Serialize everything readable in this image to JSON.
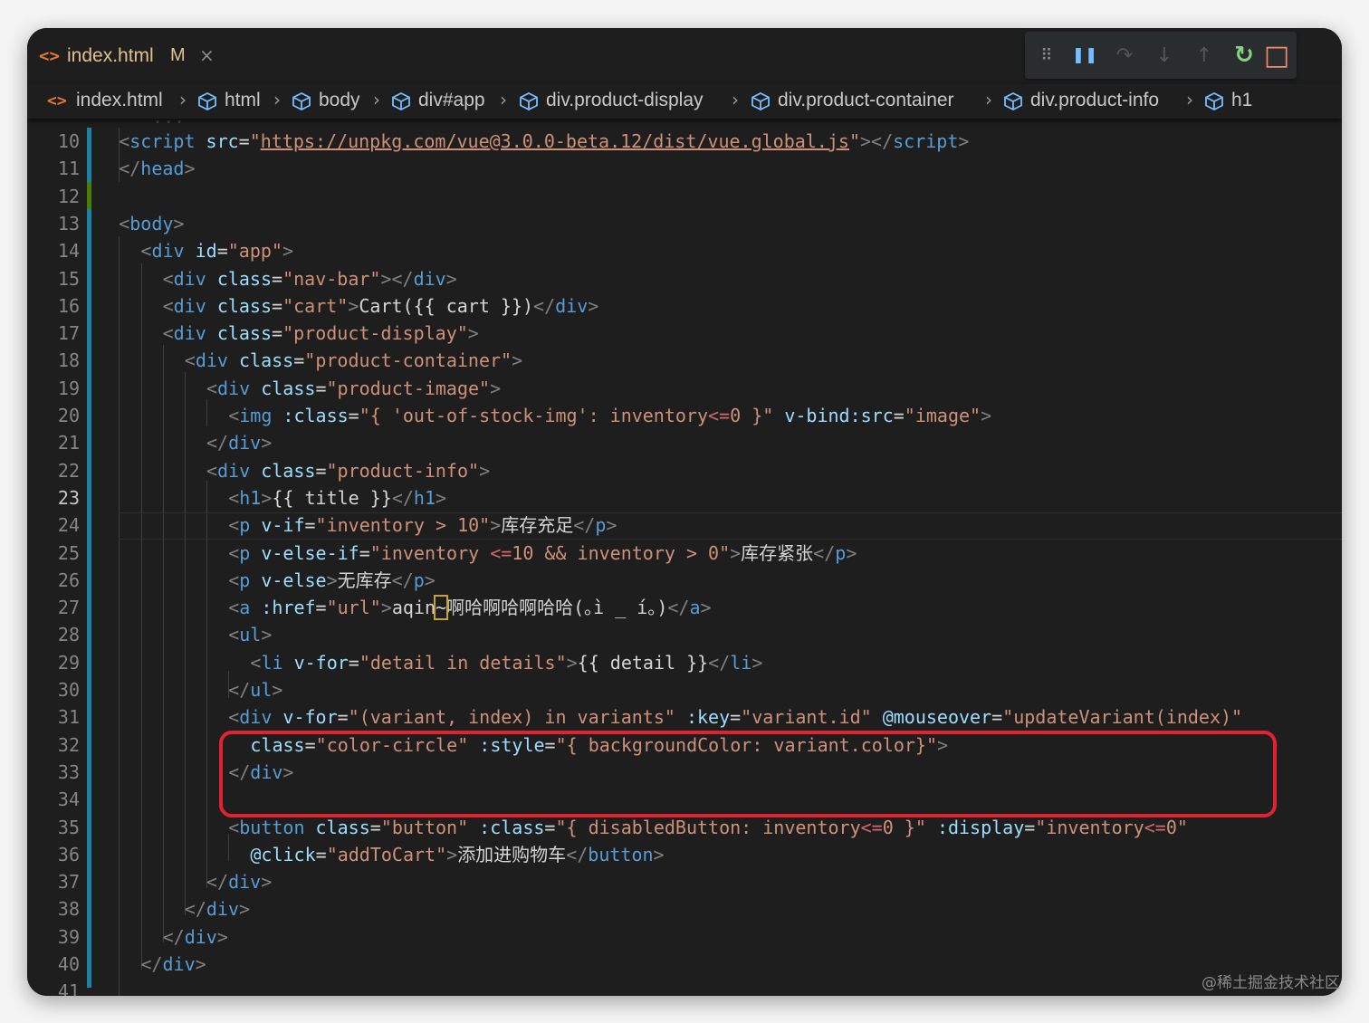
{
  "tab": {
    "icon": "<>",
    "name": "index.html",
    "status": "M",
    "close": "×"
  },
  "debug_toolbar": {
    "grip": "⠿",
    "pause": "❚❚",
    "step_over": "↷",
    "step_into": "↓",
    "step_out": "↑",
    "restart": "↻",
    "stop": "□"
  },
  "breadcrumb": {
    "file_icon": "<>",
    "items": [
      "index.html",
      "html",
      "body",
      "div#app",
      "div.product-display",
      "div.product-container",
      "div.product-info",
      "h1"
    ]
  },
  "editor": {
    "active_line": 23,
    "lines": [
      {
        "num": "10",
        "tokens": [
          {
            "t": "punct",
            "v": "<"
          },
          {
            "t": "tag",
            "v": "script"
          },
          {
            "t": "text",
            "v": " "
          },
          {
            "t": "attr",
            "v": "src"
          },
          {
            "t": "eq",
            "v": "="
          },
          {
            "t": "str",
            "v": "\""
          },
          {
            "t": "url",
            "v": "https://unpkg.com/vue@3.0.0-beta.12/dist/vue.global.js"
          },
          {
            "t": "str",
            "v": "\""
          },
          {
            "t": "punct",
            "v": "></"
          },
          {
            "t": "tag",
            "v": "script"
          },
          {
            "t": "punct",
            "v": ">"
          }
        ]
      },
      {
        "num": "11",
        "tokens": [
          {
            "t": "punct",
            "v": "</"
          },
          {
            "t": "tag",
            "v": "head"
          },
          {
            "t": "punct",
            "v": ">"
          }
        ]
      },
      {
        "num": "12",
        "tokens": []
      },
      {
        "num": "13",
        "tokens": [
          {
            "t": "punct",
            "v": "<"
          },
          {
            "t": "tag",
            "v": "body"
          },
          {
            "t": "punct",
            "v": ">"
          }
        ]
      },
      {
        "num": "14",
        "tokens": [
          {
            "t": "punct",
            "v": "<"
          },
          {
            "t": "tag",
            "v": "div"
          },
          {
            "t": "text",
            "v": " "
          },
          {
            "t": "attr",
            "v": "id"
          },
          {
            "t": "eq",
            "v": "="
          },
          {
            "t": "str",
            "v": "\"app\""
          },
          {
            "t": "punct",
            "v": ">"
          }
        ]
      },
      {
        "num": "15",
        "tokens": [
          {
            "t": "punct",
            "v": "<"
          },
          {
            "t": "tag",
            "v": "div"
          },
          {
            "t": "text",
            "v": " "
          },
          {
            "t": "attr",
            "v": "class"
          },
          {
            "t": "eq",
            "v": "="
          },
          {
            "t": "str",
            "v": "\"nav-bar\""
          },
          {
            "t": "punct",
            "v": "></"
          },
          {
            "t": "tag",
            "v": "div"
          },
          {
            "t": "punct",
            "v": ">"
          }
        ]
      },
      {
        "num": "16",
        "tokens": [
          {
            "t": "punct",
            "v": "<"
          },
          {
            "t": "tag",
            "v": "div"
          },
          {
            "t": "text",
            "v": " "
          },
          {
            "t": "attr",
            "v": "class"
          },
          {
            "t": "eq",
            "v": "="
          },
          {
            "t": "str",
            "v": "\"cart\""
          },
          {
            "t": "punct",
            "v": ">"
          },
          {
            "t": "text",
            "v": "Cart({{ cart }})"
          },
          {
            "t": "punct",
            "v": "</"
          },
          {
            "t": "tag",
            "v": "div"
          },
          {
            "t": "punct",
            "v": ">"
          }
        ]
      },
      {
        "num": "17",
        "tokens": [
          {
            "t": "punct",
            "v": "<"
          },
          {
            "t": "tag",
            "v": "div"
          },
          {
            "t": "text",
            "v": " "
          },
          {
            "t": "attr",
            "v": "class"
          },
          {
            "t": "eq",
            "v": "="
          },
          {
            "t": "str",
            "v": "\"product-display\""
          },
          {
            "t": "punct",
            "v": ">"
          }
        ]
      },
      {
        "num": "18",
        "tokens": [
          {
            "t": "punct",
            "v": "<"
          },
          {
            "t": "tag",
            "v": "div"
          },
          {
            "t": "text",
            "v": " "
          },
          {
            "t": "attr",
            "v": "class"
          },
          {
            "t": "eq",
            "v": "="
          },
          {
            "t": "str",
            "v": "\"product-container\""
          },
          {
            "t": "punct",
            "v": ">"
          }
        ]
      },
      {
        "num": "19",
        "tokens": [
          {
            "t": "punct",
            "v": "<"
          },
          {
            "t": "tag",
            "v": "div"
          },
          {
            "t": "text",
            "v": " "
          },
          {
            "t": "attr",
            "v": "class"
          },
          {
            "t": "eq",
            "v": "="
          },
          {
            "t": "str",
            "v": "\"product-image\""
          },
          {
            "t": "punct",
            "v": ">"
          }
        ]
      },
      {
        "num": "20",
        "tokens": [
          {
            "t": "punct",
            "v": "<"
          },
          {
            "t": "tag",
            "v": "img"
          },
          {
            "t": "text",
            "v": " "
          },
          {
            "t": "attr",
            "v": ":class"
          },
          {
            "t": "eq",
            "v": "="
          },
          {
            "t": "str",
            "v": "\"{ 'out-of-stock-img': inventory"
          },
          {
            "t": "op",
            "v": "<="
          },
          {
            "t": "str",
            "v": "0 }\""
          },
          {
            "t": "text",
            "v": " "
          },
          {
            "t": "attr",
            "v": "v-bind:src"
          },
          {
            "t": "eq",
            "v": "="
          },
          {
            "t": "str",
            "v": "\"image\""
          },
          {
            "t": "punct",
            "v": ">"
          }
        ]
      },
      {
        "num": "21",
        "tokens": [
          {
            "t": "punct",
            "v": "</"
          },
          {
            "t": "tag",
            "v": "div"
          },
          {
            "t": "punct",
            "v": ">"
          }
        ]
      },
      {
        "num": "22",
        "tokens": [
          {
            "t": "punct",
            "v": "<"
          },
          {
            "t": "tag",
            "v": "div"
          },
          {
            "t": "text",
            "v": " "
          },
          {
            "t": "attr",
            "v": "class"
          },
          {
            "t": "eq",
            "v": "="
          },
          {
            "t": "str",
            "v": "\"product-info\""
          },
          {
            "t": "punct",
            "v": ">"
          }
        ]
      },
      {
        "num": "23",
        "tokens": [
          {
            "t": "punct",
            "v": "<"
          },
          {
            "t": "tag",
            "v": "h1"
          },
          {
            "t": "punct",
            "v": ">"
          },
          {
            "t": "text",
            "v": "{{ title }}"
          },
          {
            "t": "punct",
            "v": "</"
          },
          {
            "t": "tag",
            "v": "h1"
          },
          {
            "t": "punct",
            "v": ">"
          }
        ]
      },
      {
        "num": "24",
        "tokens": [
          {
            "t": "punct",
            "v": "<"
          },
          {
            "t": "tag",
            "v": "p"
          },
          {
            "t": "text",
            "v": " "
          },
          {
            "t": "attr",
            "v": "v-if"
          },
          {
            "t": "eq",
            "v": "="
          },
          {
            "t": "str",
            "v": "\"inventory > 10\""
          },
          {
            "t": "punct",
            "v": ">"
          },
          {
            "t": "text",
            "v": "库存充足"
          },
          {
            "t": "punct",
            "v": "</"
          },
          {
            "t": "tag",
            "v": "p"
          },
          {
            "t": "punct",
            "v": ">"
          }
        ]
      },
      {
        "num": "25",
        "tokens": [
          {
            "t": "punct",
            "v": "<"
          },
          {
            "t": "tag",
            "v": "p"
          },
          {
            "t": "text",
            "v": " "
          },
          {
            "t": "attr",
            "v": "v-else-if"
          },
          {
            "t": "eq",
            "v": "="
          },
          {
            "t": "str",
            "v": "\"inventory "
          },
          {
            "t": "op",
            "v": "<="
          },
          {
            "t": "str",
            "v": "10 && inventory > 0\""
          },
          {
            "t": "punct",
            "v": ">"
          },
          {
            "t": "text",
            "v": "库存紧张"
          },
          {
            "t": "punct",
            "v": "</"
          },
          {
            "t": "tag",
            "v": "p"
          },
          {
            "t": "punct",
            "v": ">"
          }
        ]
      },
      {
        "num": "26",
        "tokens": [
          {
            "t": "punct",
            "v": "<"
          },
          {
            "t": "tag",
            "v": "p"
          },
          {
            "t": "text",
            "v": " "
          },
          {
            "t": "attr",
            "v": "v-else"
          },
          {
            "t": "punct",
            "v": ">"
          },
          {
            "t": "text",
            "v": "无库存"
          },
          {
            "t": "punct",
            "v": "</"
          },
          {
            "t": "tag",
            "v": "p"
          },
          {
            "t": "punct",
            "v": ">"
          }
        ]
      },
      {
        "num": "27",
        "tokens": [
          {
            "t": "punct",
            "v": "<"
          },
          {
            "t": "tag",
            "v": "a"
          },
          {
            "t": "text",
            "v": " "
          },
          {
            "t": "attr",
            "v": ":href"
          },
          {
            "t": "eq",
            "v": "="
          },
          {
            "t": "str",
            "v": "\"url\""
          },
          {
            "t": "punct",
            "v": ">"
          },
          {
            "t": "text",
            "v": "aqin"
          },
          {
            "t": "cursor",
            "v": "~"
          },
          {
            "t": "text",
            "v": "啊哈啊哈啊哈哈(｡ì _ í｡)"
          },
          {
            "t": "punct",
            "v": "</"
          },
          {
            "t": "tag",
            "v": "a"
          },
          {
            "t": "punct",
            "v": ">"
          }
        ]
      },
      {
        "num": "28",
        "tokens": [
          {
            "t": "punct",
            "v": "<"
          },
          {
            "t": "tag",
            "v": "ul"
          },
          {
            "t": "punct",
            "v": ">"
          }
        ]
      },
      {
        "num": "29",
        "tokens": [
          {
            "t": "punct",
            "v": "<"
          },
          {
            "t": "tag",
            "v": "li"
          },
          {
            "t": "text",
            "v": " "
          },
          {
            "t": "attr",
            "v": "v-for"
          },
          {
            "t": "eq",
            "v": "="
          },
          {
            "t": "str",
            "v": "\"detail in details\""
          },
          {
            "t": "punct",
            "v": ">"
          },
          {
            "t": "text",
            "v": "{{ detail }}"
          },
          {
            "t": "punct",
            "v": "</"
          },
          {
            "t": "tag",
            "v": "li"
          },
          {
            "t": "punct",
            "v": ">"
          }
        ]
      },
      {
        "num": "30",
        "tokens": [
          {
            "t": "punct",
            "v": "</"
          },
          {
            "t": "tag",
            "v": "ul"
          },
          {
            "t": "punct",
            "v": ">"
          }
        ]
      },
      {
        "num": "31",
        "tokens": [
          {
            "t": "punct",
            "v": "<"
          },
          {
            "t": "tag",
            "v": "div"
          },
          {
            "t": "text",
            "v": " "
          },
          {
            "t": "attr",
            "v": "v-for"
          },
          {
            "t": "eq",
            "v": "="
          },
          {
            "t": "str",
            "v": "\"(variant, index) in variants\""
          },
          {
            "t": "text",
            "v": " "
          },
          {
            "t": "attr",
            "v": ":key"
          },
          {
            "t": "eq",
            "v": "="
          },
          {
            "t": "str",
            "v": "\"variant.id\""
          },
          {
            "t": "text",
            "v": " "
          },
          {
            "t": "attr",
            "v": "@mouseover"
          },
          {
            "t": "eq",
            "v": "="
          },
          {
            "t": "str",
            "v": "\"updateVariant(index)\""
          }
        ]
      },
      {
        "num": "32",
        "tokens": [
          {
            "t": "attr",
            "v": "class"
          },
          {
            "t": "eq",
            "v": "="
          },
          {
            "t": "str",
            "v": "\"color-circle\""
          },
          {
            "t": "text",
            "v": " "
          },
          {
            "t": "attr",
            "v": ":style"
          },
          {
            "t": "eq",
            "v": "="
          },
          {
            "t": "str",
            "v": "\"{ backgroundColor: variant.color}\""
          },
          {
            "t": "punct",
            "v": ">"
          }
        ]
      },
      {
        "num": "33",
        "tokens": [
          {
            "t": "punct",
            "v": "</"
          },
          {
            "t": "tag",
            "v": "div"
          },
          {
            "t": "punct",
            "v": ">"
          }
        ]
      },
      {
        "num": "34",
        "tokens": []
      },
      {
        "num": "35",
        "tokens": [
          {
            "t": "punct",
            "v": "<"
          },
          {
            "t": "tag",
            "v": "button"
          },
          {
            "t": "text",
            "v": " "
          },
          {
            "t": "attr",
            "v": "class"
          },
          {
            "t": "eq",
            "v": "="
          },
          {
            "t": "str",
            "v": "\"button\""
          },
          {
            "t": "text",
            "v": " "
          },
          {
            "t": "attr",
            "v": ":class"
          },
          {
            "t": "eq",
            "v": "="
          },
          {
            "t": "str",
            "v": "\"{ disabledButton: inventory"
          },
          {
            "t": "op",
            "v": "<="
          },
          {
            "t": "str",
            "v": "0 }\""
          },
          {
            "t": "text",
            "v": " "
          },
          {
            "t": "attr",
            "v": ":display"
          },
          {
            "t": "eq",
            "v": "="
          },
          {
            "t": "str",
            "v": "\"inventory"
          },
          {
            "t": "op",
            "v": "<="
          },
          {
            "t": "str",
            "v": "0\""
          }
        ]
      },
      {
        "num": "36",
        "tokens": [
          {
            "t": "attr",
            "v": "@click"
          },
          {
            "t": "eq",
            "v": "="
          },
          {
            "t": "str",
            "v": "\"addToCart\""
          },
          {
            "t": "punct",
            "v": ">"
          },
          {
            "t": "text",
            "v": "添加进购物车"
          },
          {
            "t": "punct",
            "v": "</"
          },
          {
            "t": "tag",
            "v": "button"
          },
          {
            "t": "punct",
            "v": ">"
          }
        ]
      },
      {
        "num": "37",
        "tokens": [
          {
            "t": "punct",
            "v": "</"
          },
          {
            "t": "tag",
            "v": "div"
          },
          {
            "t": "punct",
            "v": ">"
          }
        ]
      },
      {
        "num": "38",
        "tokens": [
          {
            "t": "punct",
            "v": "</"
          },
          {
            "t": "tag",
            "v": "div"
          },
          {
            "t": "punct",
            "v": ">"
          }
        ]
      },
      {
        "num": "39",
        "tokens": [
          {
            "t": "punct",
            "v": "</"
          },
          {
            "t": "tag",
            "v": "div"
          },
          {
            "t": "punct",
            "v": ">"
          }
        ]
      },
      {
        "num": "40",
        "tokens": [
          {
            "t": "punct",
            "v": "</"
          },
          {
            "t": "tag",
            "v": "div"
          },
          {
            "t": "punct",
            "v": ">"
          }
        ]
      },
      {
        "num": "41",
        "tokens": []
      }
    ]
  },
  "colors": {
    "highlight_box": "#e0232f",
    "modified_tab": "#e2c08d",
    "restart_icon": "#89d185",
    "stop_icon": "#f48771",
    "pause_icon": "#75beff"
  },
  "watermark": "@稀土掘金技术社区"
}
